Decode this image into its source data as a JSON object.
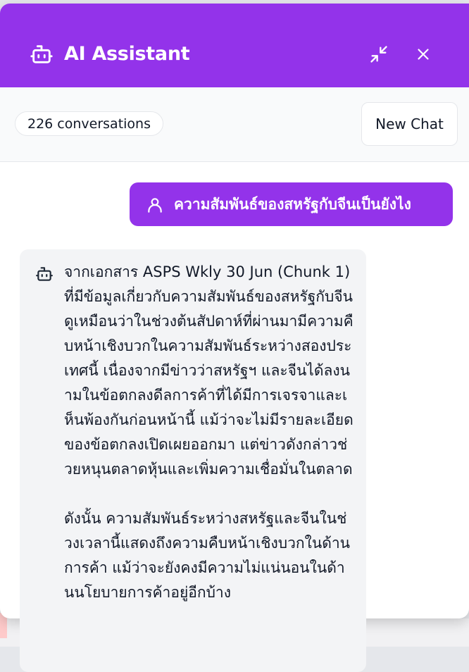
{
  "header": {
    "title": "AI Assistant",
    "icon": "robot-icon",
    "minimize_icon": "minimize-arrows-icon",
    "close_icon": "close-icon"
  },
  "toolbar": {
    "conversation_count": "226 conversations",
    "new_chat_label": "New Chat"
  },
  "messages": [
    {
      "role": "user",
      "icon": "user-icon",
      "text": "ความสัมพันธ์ของสหรัฐกับจีนเป็นยังไง"
    },
    {
      "role": "assistant",
      "icon": "robot-icon",
      "paragraphs": [
        "จากเอกสาร ASPS Wkly 30 Jun (Chunk 1) ที่มีข้อมูลเกี่ยวกับความสัมพันธ์ของสหรัฐกับจีน ดูเหมือนว่าในช่วงต้นสัปดาห์ที่ผ่านมามีความคืบหน้าเชิงบวกในความสัมพันธ์ระหว่างสองประเทศนี้ เนื่องจากมีข่าวว่าสหรัฐฯ และจีนได้ลงนามในข้อตกลงดีลการค้าที่ได้มีการเจรจาและเห็นพ้องกันก่อนหน้านี้ แม้ว่าจะไม่มีรายละเอียดของข้อตกลงเปิดเผยออกมา แต่ข่าวดังกล่าวช่วยหนุนตลาดหุ้นและเพิ่มความเชื่อมั่นในตลาด",
        "ดังนั้น ความสัมพันธ์ระหว่างสหรัฐและจีนในช่วงเวลานี้แสดงถึงความคืบหน้าเชิงบวกในด้านการค้า แม้ว่าจะยังคงมีความไม่แน่นอนในด้านนโยบายการค้าอยู่อีกบ้าง"
      ]
    }
  ],
  "colors": {
    "brand": "#9333ea",
    "toolbar_bg": "#f9fafb",
    "bot_bubble": "#f3f4f6",
    "text": "#111827"
  }
}
